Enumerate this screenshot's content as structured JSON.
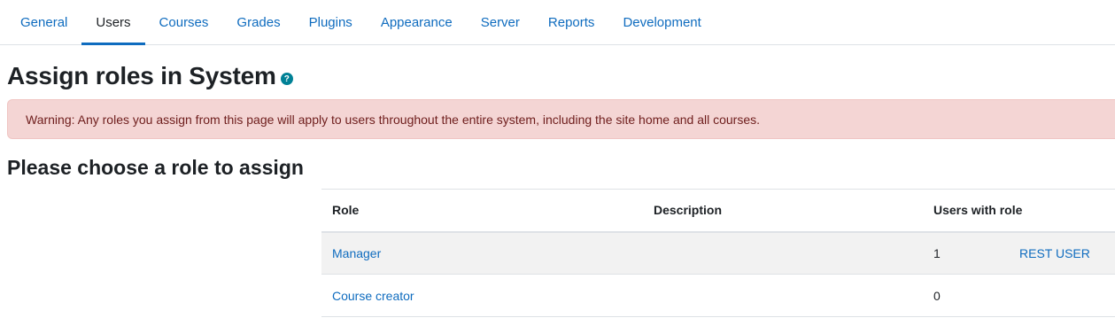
{
  "nav": {
    "tabs": [
      {
        "label": "General"
      },
      {
        "label": "Users"
      },
      {
        "label": "Courses"
      },
      {
        "label": "Grades"
      },
      {
        "label": "Plugins"
      },
      {
        "label": "Appearance"
      },
      {
        "label": "Server"
      },
      {
        "label": "Reports"
      },
      {
        "label": "Development"
      }
    ],
    "active": "Users"
  },
  "page": {
    "title": "Assign roles in System",
    "help_icon_glyph": "?"
  },
  "alert": {
    "text": "Warning: Any roles you assign from this page will apply to users throughout the entire system, including the site home and all courses."
  },
  "section": {
    "title": "Please choose a role to assign"
  },
  "table": {
    "headers": {
      "role": "Role",
      "description": "Description",
      "users": "Users with role"
    },
    "rows": [
      {
        "role": "Manager",
        "description": "",
        "count": "1",
        "user": "REST USER"
      },
      {
        "role": "Course creator",
        "description": "",
        "count": "0",
        "user": ""
      }
    ]
  },
  "colors": {
    "link": "#0f6cbf",
    "alert_bg": "#f4d5d4",
    "alert_text": "#6e1d1c",
    "help_icon": "#008196"
  }
}
